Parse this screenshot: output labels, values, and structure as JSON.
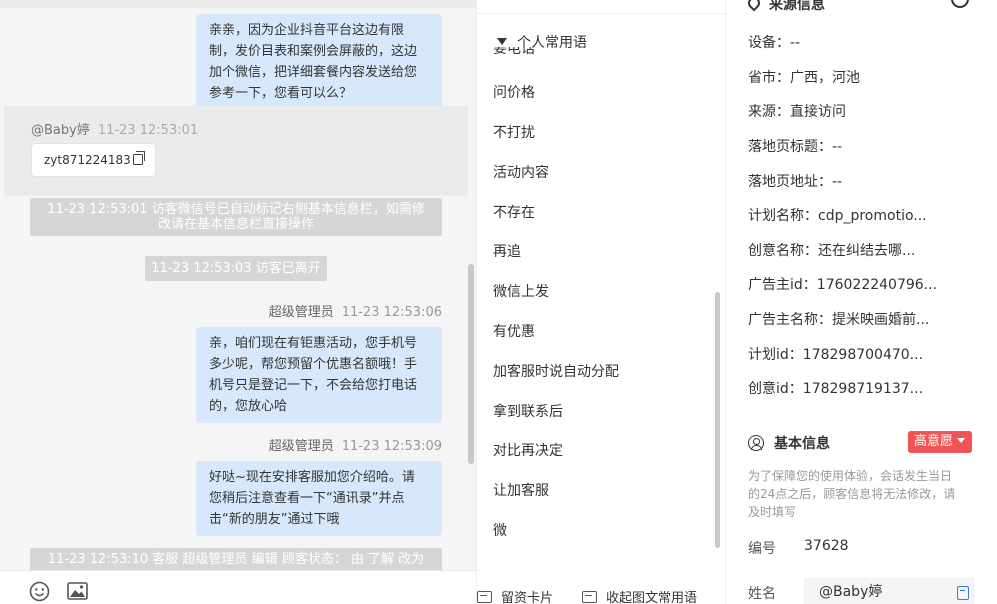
{
  "chat": {
    "messages_agent_1": {
      "lines": [
        "亲亲，因为企业抖音平台这边有限",
        "制，发价目表和案例会屏蔽的，这边",
        "加个微信，把详细套餐内容发送给您",
        "参考一下，您看可以么？"
      ]
    },
    "visitor": {
      "name": "@Baby婷",
      "time": "11-23 12:53:01",
      "message": "zyt871224183"
    },
    "system_note_1": {
      "lines": [
        "11-23 12:53:01 访客微信号已自动标记右侧基本信息栏，如需修",
        "改请在基本信息栏直接操作"
      ]
    },
    "system_note_2": "11-23 12:53:03 访客已离开",
    "agent_msg_2": {
      "sender": "超级管理员",
      "time": "11-23 12:53:06",
      "lines": [
        "亲，咱们现在有钜惠活动，您手机号",
        "多少呢，帮您预留个优惠名额哦！手",
        "机号只是登记一下，不会给您打电话",
        "的，您放心哈"
      ]
    },
    "agent_msg_3": {
      "sender": "超级管理员",
      "time": "11-23 12:53:09",
      "lines": [
        "好哒~现在安排客服加您介绍哈。请",
        "您稍后注意查看一下“通讯录”并点",
        "击“新的朋友”通过下哦"
      ]
    },
    "system_note_3": "11-23 12:53:10 客服 超级管理员 编辑 顾客状态： 由 了解 改为",
    "toolbar": {
      "emoji_icon": "smiley-icon",
      "image_icon": "image-icon"
    }
  },
  "phrases": {
    "header": "个人常用语",
    "partial_item": "要电话",
    "items": [
      "问价格",
      "不打扰",
      "活动内容",
      "不存在",
      "再追",
      "微信上发",
      "有优惠",
      "加客服时说自动分配",
      "拿到联系后",
      "对比再决定",
      "让加客服",
      "微"
    ],
    "footer": {
      "left": "留资卡片",
      "right": "收起图文常用语"
    }
  },
  "info": {
    "source_title": "来源信息",
    "source_rows": [
      {
        "k": "设备：",
        "v": "--"
      },
      {
        "k": "省市：",
        "v": "广西，河池"
      },
      {
        "k": "来源：",
        "v": "直接访问"
      },
      {
        "k": "落地页标题：",
        "v": "--"
      },
      {
        "k": "落地页地址：",
        "v": "--"
      },
      {
        "k": "计划名称：",
        "v": "cdp_promotio..."
      },
      {
        "k": "创意名称：",
        "v": "还在纠结去哪..."
      },
      {
        "k": "广告主id：",
        "v": "176022240796..."
      },
      {
        "k": "广告主名称：",
        "v": "提米映画婚前..."
      },
      {
        "k": "计划id：",
        "v": "178298700470..."
      },
      {
        "k": "创意id：",
        "v": "178298719137..."
      }
    ],
    "basic_title": "基本信息",
    "intent_badge": "高意愿",
    "notice_lines": [
      "为了保障您的使用体验，会话发生当日",
      "的24点之后，顾客信息将无法修改，请",
      "及时填写"
    ],
    "number_label": "编号",
    "number_value": "37628",
    "name_label": "姓名",
    "name_value": "@Baby婷"
  }
}
